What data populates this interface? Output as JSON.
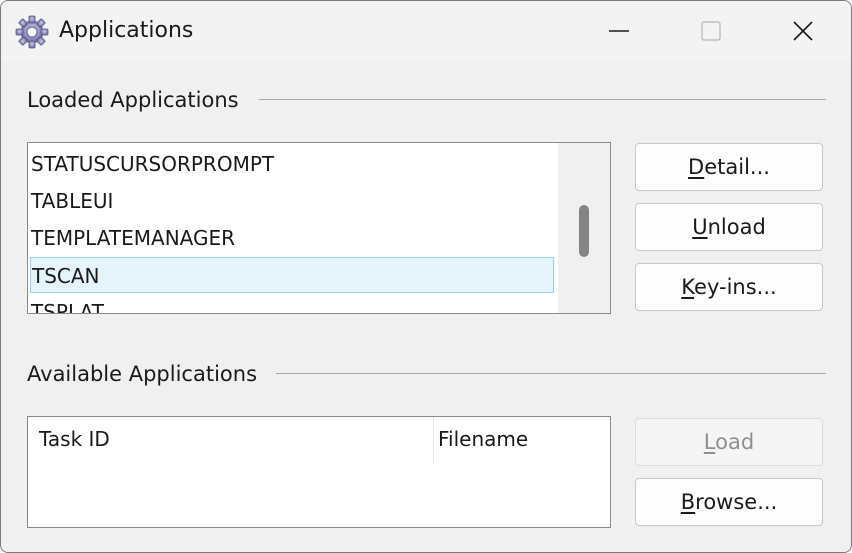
{
  "window": {
    "title": "Applications",
    "icon": "gear-icon"
  },
  "caption_buttons": {
    "minimize": "minimize-icon",
    "maximize": "maximize-icon",
    "close": "close-icon"
  },
  "loaded": {
    "label": "Loaded Applications",
    "items": [
      "STATUSCURSORPROMPT",
      "TABLEUI",
      "TEMPLATEMANAGER",
      "TSCAN",
      "TSPLAT"
    ],
    "selected": "TSCAN"
  },
  "loaded_buttons": {
    "detail": {
      "mnemonic": "D",
      "rest": "etail..."
    },
    "unload": {
      "mnemonic": "U",
      "rest": "nload"
    },
    "keyins": {
      "mnemonic": "K",
      "rest": "ey-ins..."
    }
  },
  "available": {
    "label": "Available Applications",
    "columns": [
      "Task ID",
      "Filename"
    ]
  },
  "available_buttons": {
    "load": {
      "mnemonic": "L",
      "rest": "oad",
      "enabled": false
    },
    "browse": {
      "mnemonic": "B",
      "rest": "rowse..."
    }
  },
  "colors": {
    "window_bg": "#f0f0f0",
    "selection_bg": "#e5f3fb",
    "selection_border": "#99d1f0",
    "scroll_thumb": "#858585"
  }
}
